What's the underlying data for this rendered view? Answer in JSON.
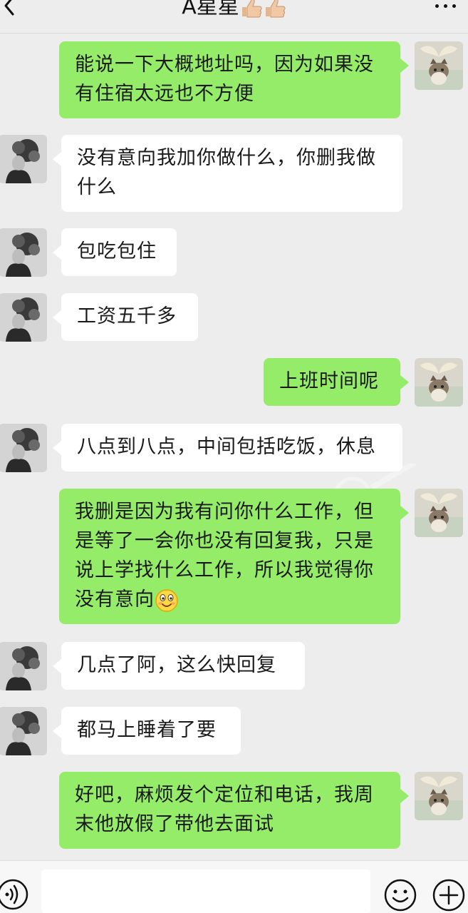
{
  "header": {
    "title": "A星星",
    "title_emoji": "thumbs-up-icon"
  },
  "messages": [
    {
      "side": "out",
      "text": "能说一下大概地址吗，因为如果没有住宿太远也不方便"
    },
    {
      "side": "in",
      "text": "没有意向我加你做什么，你删我做什么"
    },
    {
      "side": "in",
      "text": "包吃包住"
    },
    {
      "side": "in",
      "text": "工资五千多"
    },
    {
      "side": "out",
      "text": "上班时间呢"
    },
    {
      "side": "in",
      "text": "八点到八点，中间包括吃饭，休息"
    },
    {
      "side": "out",
      "text": "我删是因为我有问你什么工作，但是等了一会你也没有回复我，只是说上学找什么工作，所以我觉得你没有意向",
      "emoji": "smiley-emoji"
    },
    {
      "side": "in",
      "text": "几点了阿，这么快回复"
    },
    {
      "side": "in",
      "text": "都马上睡着了要"
    },
    {
      "side": "out",
      "text": "好吧，麻烦发个定位和电话，我周末他放假了带他去面试"
    }
  ],
  "input": {
    "value": "",
    "placeholder": ""
  },
  "colors": {
    "background": "#ededed",
    "outgoing_bubble": "#95ec69",
    "incoming_bubble": "#ffffff"
  }
}
